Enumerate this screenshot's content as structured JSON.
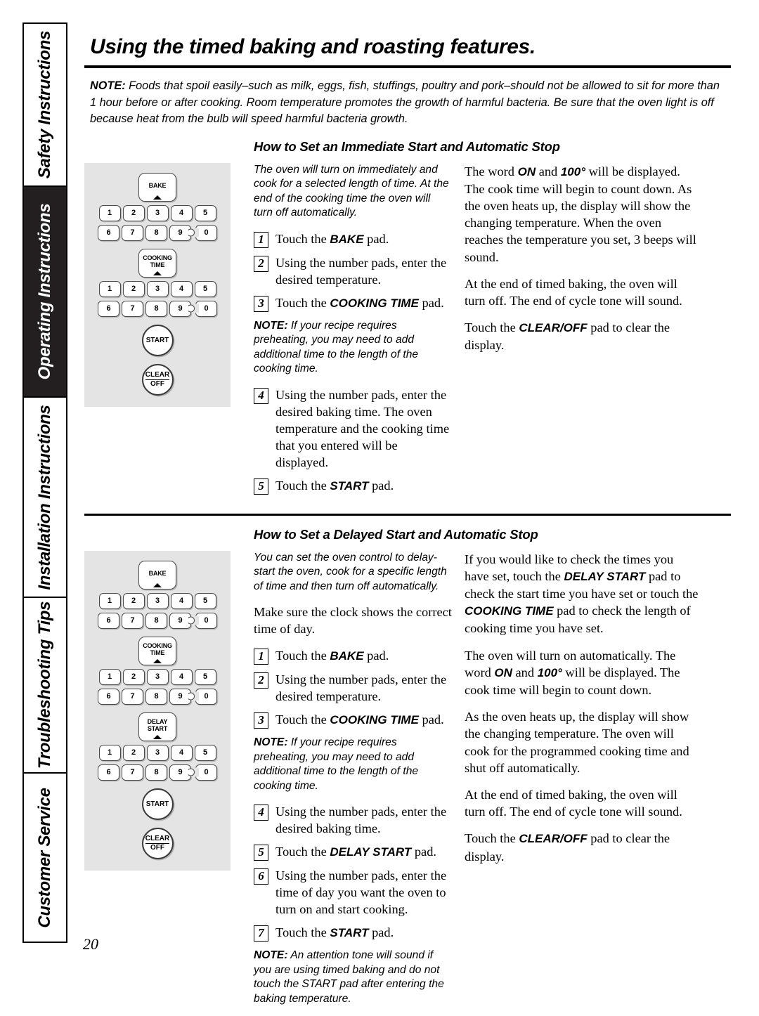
{
  "sidebar": {
    "items": [
      {
        "id": "safety",
        "label": "Safety Instructions",
        "active": false
      },
      {
        "id": "operating",
        "label": "Operating Instructions",
        "active": true
      },
      {
        "id": "installation",
        "label": "Installation Instructions",
        "active": false
      },
      {
        "id": "troubleshooting",
        "label": "Troubleshooting Tips",
        "active": false
      },
      {
        "id": "customer",
        "label": "Customer Service",
        "active": false
      }
    ]
  },
  "header": {
    "title": "Using the timed baking and roasting features."
  },
  "intro": {
    "note_label": "NOTE:",
    "note_body": " Foods that spoil easily–such as milk, eggs, fish, stuffings, poultry and pork–should not be allowed to sit for more than 1 hour before or after cooking. Room temperature promotes the growth of harmful bacteria. Be sure that the oven light is off because heat from the bulb will speed harmful bacteria growth."
  },
  "section1": {
    "heading": "How to Set an Immediate Start and Automatic Stop",
    "intro": "The oven will turn on immediately and cook for a selected length of time. At the end of the cooking time the oven will turn off automatically.",
    "steps": [
      {
        "num": "1",
        "pre": "Touch the ",
        "bold": "BAKE",
        "post": " pad."
      },
      {
        "num": "2",
        "pre": "Using the number pads, enter the desired temperature.",
        "bold": "",
        "post": ""
      },
      {
        "num": "3",
        "pre": "Touch the ",
        "bold": "COOKING TIME",
        "post": " pad."
      }
    ],
    "note_label": "NOTE:",
    "note_body": " If your recipe requires preheating, you may need to add additional time to the length of the cooking time.",
    "steps2": [
      {
        "num": "4",
        "pre": "Using the number pads, enter the desired baking time. The oven temperature and the cooking time that you entered will be displayed.",
        "bold": "",
        "post": ""
      },
      {
        "num": "5",
        "pre": "Touch the ",
        "bold": "START",
        "post": " pad."
      }
    ],
    "right": {
      "p1_a": "The word ",
      "p1_on": "ON",
      "p1_b": " and ",
      "p1_temp": "100°",
      "p1_c": " will be displayed. The cook time will begin to count down. As the oven heats up, the display will show the changing temperature. When the oven reaches the temperature you set, 3 beeps will sound.",
      "p2": "At the end of timed baking, the oven will turn off. The end of cycle tone will sound.",
      "p3_a": "Touch the ",
      "p3_bold": "CLEAR/OFF",
      "p3_b": " pad to clear the display."
    },
    "panel": {
      "pads": [
        "BAKE",
        "COOKING TIME"
      ],
      "number_rows": [
        "1",
        "2",
        "3",
        "4",
        "5",
        "6",
        "7",
        "8",
        "9",
        "0"
      ],
      "start_label": "START",
      "clear_line1": "CLEAR",
      "clear_line2": "OFF"
    }
  },
  "section2": {
    "heading": "How to Set a Delayed Start and Automatic Stop",
    "intro": "You can set the oven control to delay-start the oven, cook for a specific length of time and then turn off automatically.",
    "clock_note": "Make sure the clock shows the correct time of day.",
    "steps": [
      {
        "num": "1",
        "pre": "Touch the ",
        "bold": "BAKE",
        "post": " pad."
      },
      {
        "num": "2",
        "pre": "Using the number pads, enter the desired temperature.",
        "bold": "",
        "post": ""
      },
      {
        "num": "3",
        "pre": "Touch the ",
        "bold": "COOKING TIME",
        "post": " pad."
      }
    ],
    "note_label": "NOTE:",
    "note_body": " If your recipe requires preheating, you may need to add additional time to the length of the cooking time.",
    "steps2": [
      {
        "num": "4",
        "pre": "Using the number pads, enter the desired baking time.",
        "bold": "",
        "post": ""
      },
      {
        "num": "5",
        "pre": "Touch the ",
        "bold": "DELAY START",
        "post": " pad."
      },
      {
        "num": "6",
        "pre": "Using the number pads, enter the time of day you want the oven to turn on and start cooking.",
        "bold": "",
        "post": ""
      },
      {
        "num": "7",
        "pre": "Touch the ",
        "bold": "START",
        "post": " pad."
      }
    ],
    "note2_label": "NOTE:",
    "note2_body": " An attention tone will sound if you are using timed baking and do not touch the START pad after entering the baking temperature.",
    "right": {
      "p1_a": "If you would like to check the times you have set, touch the ",
      "p1_bold1": "DELAY START",
      "p1_b": " pad to check the start time you have set or touch the ",
      "p1_bold2": "COOKING TIME",
      "p1_c": " pad to check the length of cooking time you have set.",
      "p2_a": "The oven will turn on automatically. The word ",
      "p2_on": "ON",
      "p2_b": " and ",
      "p2_temp": "100°",
      "p2_c": " will be displayed. The cook time will begin to count down.",
      "p3": "As the oven heats up, the display will show the changing temperature. The oven will cook for the programmed cooking time and shut off automatically.",
      "p4": "At the end of timed baking, the oven will turn off. The end of cycle tone will sound.",
      "p5_a": "Touch the ",
      "p5_bold": "CLEAR/OFF",
      "p5_b": " pad to clear the display."
    },
    "panel": {
      "pads": [
        "BAKE",
        "COOKING TIME",
        "DELAY START"
      ],
      "number_rows": [
        "1",
        "2",
        "3",
        "4",
        "5",
        "6",
        "7",
        "8",
        "9",
        "0"
      ],
      "start_label": "START",
      "clear_line1": "CLEAR",
      "clear_line2": "OFF"
    }
  },
  "footer": {
    "page_number": "20"
  },
  "colors": {
    "panel_background": "#e4e4e4",
    "active_tab": "#231f20",
    "ink": "#000000"
  }
}
